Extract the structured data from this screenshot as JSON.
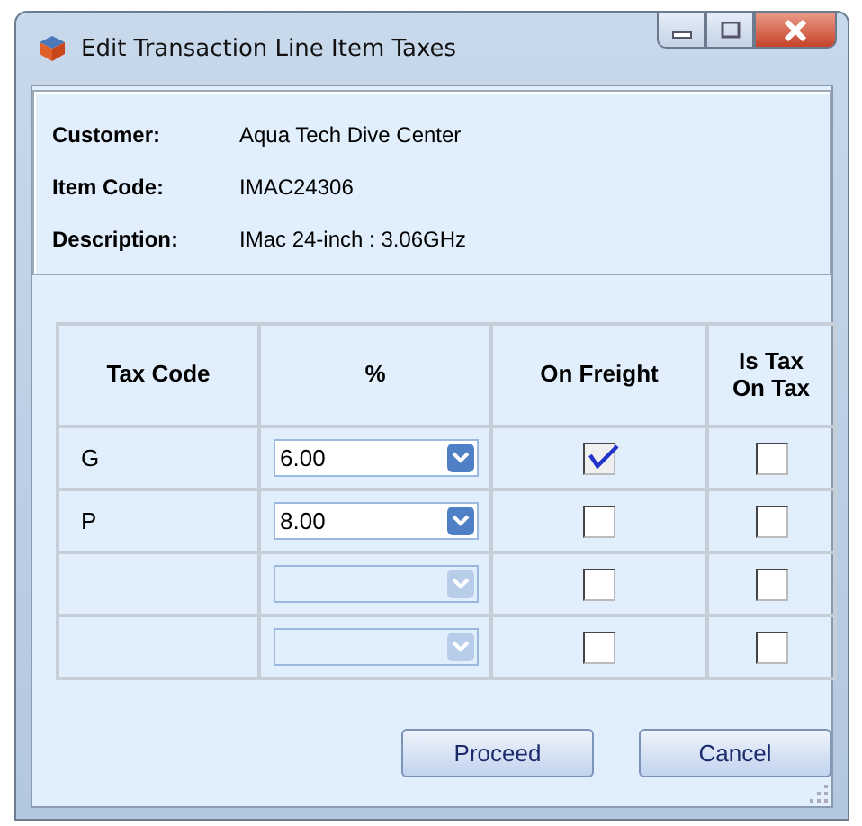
{
  "window": {
    "title": "Edit Transaction Line Item Taxes"
  },
  "info": [
    {
      "label": "Customer:",
      "value": "Aqua Tech Dive Center"
    },
    {
      "label": "Item Code:",
      "value": "IMAC24306"
    },
    {
      "label": "Description:",
      "value": "IMac  24-inch : 3.06GHz"
    }
  ],
  "table": {
    "columns": [
      "Tax Code",
      "%",
      "On Freight",
      "Is Tax On Tax"
    ],
    "rows": [
      {
        "tax_code": "G",
        "percent": "6.00",
        "percent_disabled": false,
        "on_freight": true,
        "is_tax_on_tax": false
      },
      {
        "tax_code": "P",
        "percent": "8.00",
        "percent_disabled": false,
        "on_freight": false,
        "is_tax_on_tax": false
      },
      {
        "percent_disabled": true,
        "on_freight": false,
        "is_tax_on_tax": false
      },
      {
        "percent_disabled": true,
        "on_freight": false,
        "is_tax_on_tax": false
      }
    ]
  },
  "buttons": [
    "Proceed",
    "Cancel"
  ]
}
